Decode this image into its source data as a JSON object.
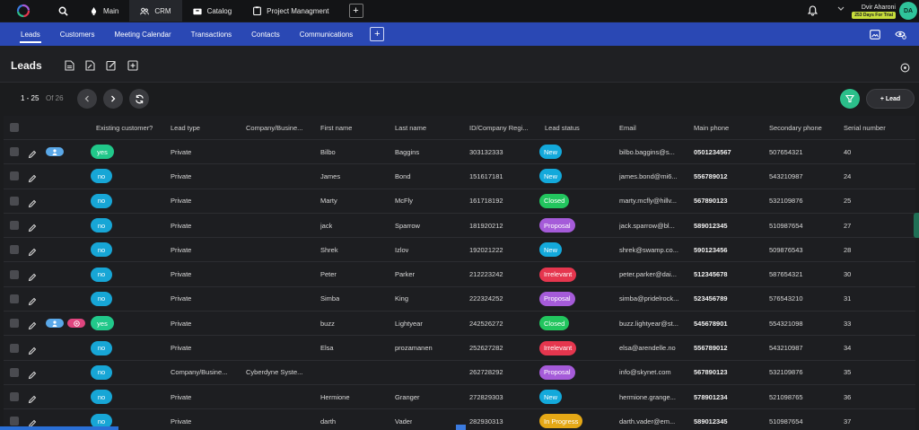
{
  "topbar": {
    "tabs": [
      {
        "label": "Main",
        "icon": "rocket-icon"
      },
      {
        "label": "CRM",
        "icon": "people-icon",
        "active": true
      },
      {
        "label": "Catalog",
        "icon": "box-icon"
      },
      {
        "label": "Project Managment",
        "icon": "clipboard-icon"
      }
    ],
    "plus_label": "+",
    "user": {
      "name": "Dvir Aharoni",
      "trial": "253 Days For Trial",
      "initials": "DA"
    }
  },
  "navbar": {
    "items": [
      {
        "label": "Leads",
        "active": true
      },
      {
        "label": "Customers"
      },
      {
        "label": "Meeting Calendar"
      },
      {
        "label": "Transactions"
      },
      {
        "label": "Contacts"
      },
      {
        "label": "Communications"
      }
    ],
    "plus_label": "+"
  },
  "page": {
    "title": "Leads"
  },
  "pager": {
    "range": "1 - 25",
    "of": "Of 26",
    "add_lead": "+ Lead"
  },
  "table": {
    "headers": [
      "Existing customer?",
      "Lead type",
      "Company/Busine...",
      "First name",
      "Last name",
      "ID/Company Regi...",
      "Lead status",
      "Email",
      "Main phone",
      "Secondary phone",
      "Serial number"
    ],
    "rows": [
      {
        "existing": "yes",
        "type": "Private",
        "company": "",
        "first": "Bilbo",
        "last": "Baggins",
        "id": "303132333",
        "status": "New",
        "email": "bilbo.baggins@s...",
        "main": "0501234567",
        "secondary": "507654321",
        "serial": "40",
        "badges": [
          "person"
        ]
      },
      {
        "existing": "no",
        "type": "Private",
        "company": "",
        "first": "James",
        "last": "Bond",
        "id": "151617181",
        "status": "New",
        "email": "james.bond@mi6...",
        "main": "556789012",
        "secondary": "543210987",
        "serial": "24",
        "badges": []
      },
      {
        "existing": "no",
        "type": "Private",
        "company": "",
        "first": "Marty",
        "last": "McFly",
        "id": "161718192",
        "status": "Closed",
        "email": "marty.mcfly@hillv...",
        "main": "567890123",
        "secondary": "532109876",
        "serial": "25",
        "badges": []
      },
      {
        "existing": "no",
        "type": "Private",
        "company": "",
        "first": "jack",
        "last": "Sparrow",
        "id": "181920212",
        "status": "Proposal",
        "email": "jack.sparrow@bl...",
        "main": "589012345",
        "secondary": "510987654",
        "serial": "27",
        "badges": []
      },
      {
        "existing": "no",
        "type": "Private",
        "company": "",
        "first": "Shrek",
        "last": "Izlov",
        "id": "192021222",
        "status": "New",
        "email": "shrek@swamp.co...",
        "main": "590123456",
        "secondary": "509876543",
        "serial": "28",
        "badges": []
      },
      {
        "existing": "no",
        "type": "Private",
        "company": "",
        "first": "Peter",
        "last": "Parker",
        "id": "212223242",
        "status": "Irrelevant",
        "email": "peter.parker@dai...",
        "main": "512345678",
        "secondary": "587654321",
        "serial": "30",
        "badges": []
      },
      {
        "existing": "no",
        "type": "Private",
        "company": "",
        "first": "Simba",
        "last": "King",
        "id": "222324252",
        "status": "Proposal",
        "email": "simba@pridelrock...",
        "main": "523456789",
        "secondary": "576543210",
        "serial": "31",
        "badges": []
      },
      {
        "existing": "yes",
        "type": "Private",
        "company": "",
        "first": "buzz",
        "last": "Lightyear",
        "id": "242526272",
        "status": "Closed",
        "email": "buzz.lightyear@st...",
        "main": "545678901",
        "secondary": "554321098",
        "serial": "33",
        "badges": [
          "person",
          "target"
        ]
      },
      {
        "existing": "no",
        "type": "Private",
        "company": "",
        "first": "Elsa",
        "last": "prozamanen",
        "id": "252627282",
        "status": "Irrelevant",
        "email": "elsa@arendelle.no",
        "main": "556789012",
        "secondary": "543210987",
        "serial": "34",
        "badges": []
      },
      {
        "existing": "no",
        "type": "Company/Busine...",
        "company": "Cyberdyne Syste...",
        "first": "",
        "last": "",
        "id": "262728292",
        "status": "Proposal",
        "email": "info@skynet.com",
        "main": "567890123",
        "secondary": "532109876",
        "serial": "35",
        "badges": []
      },
      {
        "existing": "no",
        "type": "Private",
        "company": "",
        "first": "Hermione",
        "last": "Granger",
        "id": "272829303",
        "status": "New",
        "email": "hermione.grange...",
        "main": "578901234",
        "secondary": "521098765",
        "serial": "36",
        "badges": []
      },
      {
        "existing": "no",
        "type": "Private",
        "company": "",
        "first": "darth",
        "last": "Vader",
        "id": "282930313",
        "status": "In Progress",
        "email": "darth.vader@em...",
        "main": "589012345",
        "secondary": "510987654",
        "serial": "37",
        "badges": []
      }
    ]
  },
  "colors": {
    "New": "#13a9db",
    "Closed": "#22c55e",
    "Proposal": "#a55bd9",
    "Irrelevant": "#e5364e",
    "In Progress": "#e5a816"
  }
}
